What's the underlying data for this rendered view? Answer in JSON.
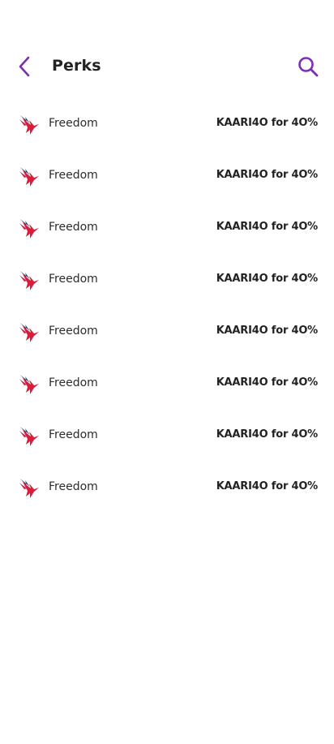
{
  "header": {
    "title": "Perks",
    "back_icon": "chevron-left-icon",
    "search_icon": "search-icon"
  },
  "colors": {
    "accent": "#7b2fb5",
    "logo_red": "#d81e3c",
    "logo_navy": "#2a3580"
  },
  "perks": [
    {
      "brand": "Freedom",
      "code": "KAARI4O for 4O%",
      "logo": "bird-logo-icon"
    },
    {
      "brand": "Freedom",
      "code": "KAARI4O for 4O%",
      "logo": "bird-logo-icon"
    },
    {
      "brand": "Freedom",
      "code": "KAARI4O for 4O%",
      "logo": "bird-logo-icon"
    },
    {
      "brand": "Freedom",
      "code": "KAARI4O for 4O%",
      "logo": "bird-logo-icon"
    },
    {
      "brand": "Freedom",
      "code": "KAARI4O for 4O%",
      "logo": "bird-logo-icon"
    },
    {
      "brand": "Freedom",
      "code": "KAARI4O for 4O%",
      "logo": "bird-logo-icon"
    },
    {
      "brand": "Freedom",
      "code": "KAARI4O for 4O%",
      "logo": "bird-logo-icon"
    },
    {
      "brand": "Freedom",
      "code": "KAARI4O for 4O%",
      "logo": "bird-logo-icon"
    }
  ]
}
